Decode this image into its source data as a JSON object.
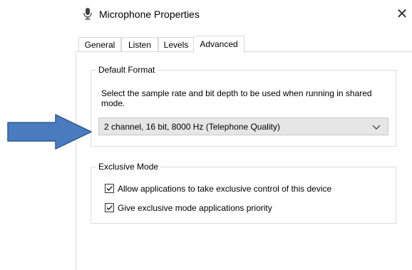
{
  "window": {
    "title": "Microphone Properties",
    "close_glyph": "✕",
    "icon": "microphone-icon"
  },
  "tabs": [
    {
      "label": "General",
      "active": false
    },
    {
      "label": "Listen",
      "active": false
    },
    {
      "label": "Levels",
      "active": false
    },
    {
      "label": "Advanced",
      "active": true
    }
  ],
  "default_format": {
    "legend": "Default Format",
    "description": "Select the sample rate and bit depth to be used when running in shared mode.",
    "selected": "2 channel, 16 bit, 8000 Hz (Telephone Quality)"
  },
  "exclusive_mode": {
    "legend": "Exclusive Mode",
    "options": [
      {
        "label": "Allow applications to take exclusive control of this device",
        "checked": true
      },
      {
        "label": "Give exclusive mode applications priority",
        "checked": true
      }
    ]
  },
  "annotation": {
    "arrow_color": "#4a7bbf",
    "arrow_stroke": "#2e5a8f"
  }
}
